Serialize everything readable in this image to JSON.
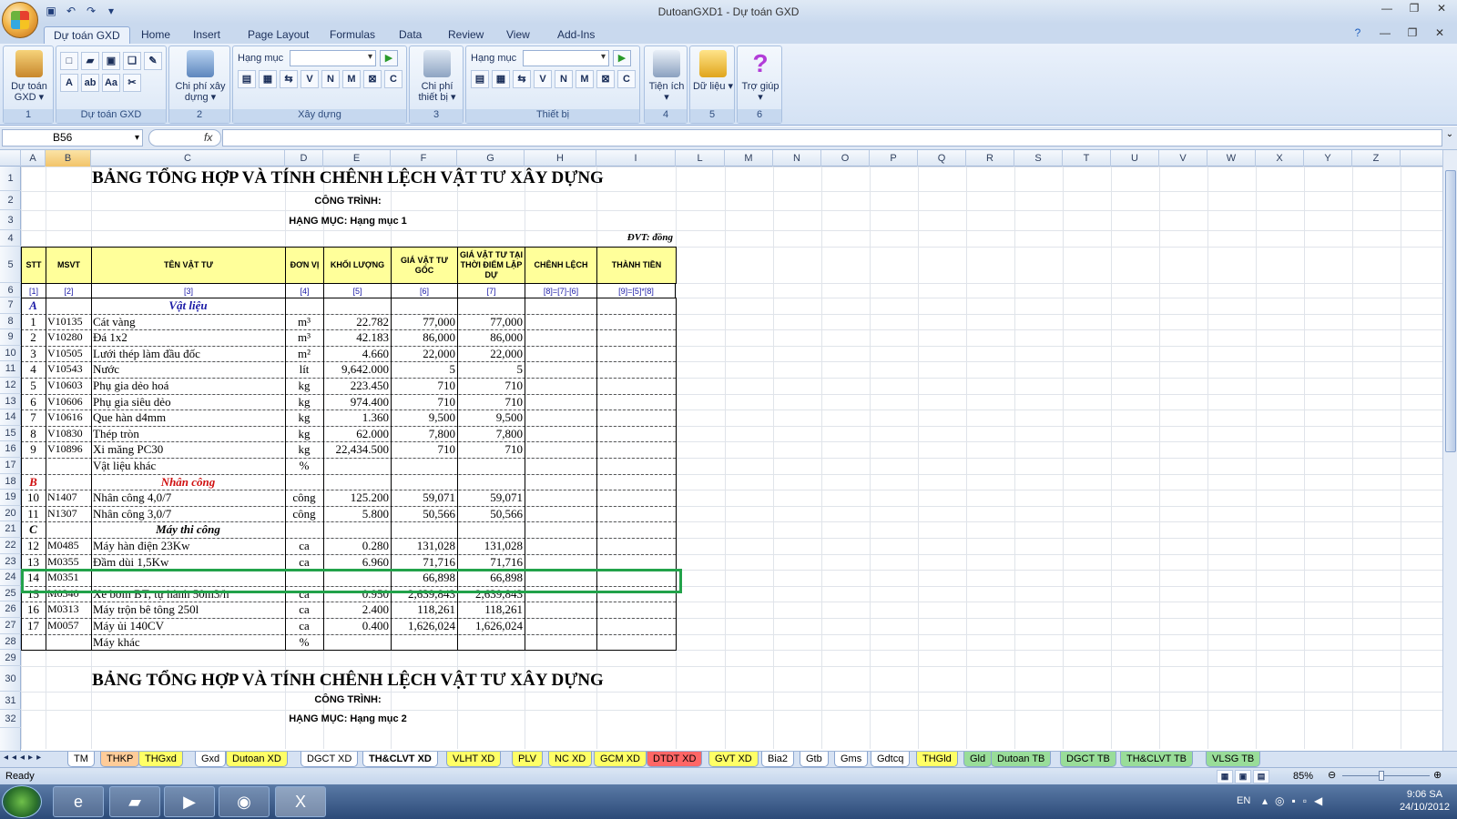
{
  "window": {
    "title": "DutoanGXD1 - Dự toán GXD"
  },
  "ribbon_tabs": [
    "Dự toán GXD",
    "Home",
    "Insert",
    "Page Layout",
    "Formulas",
    "Data",
    "Review",
    "View",
    "Add-Ins"
  ],
  "ribbon": {
    "groups": [
      {
        "label": "1",
        "button": "Dự toán GXD ▾"
      },
      {
        "label": "Dự toán GXD"
      },
      {
        "label": "2",
        "button": "Chi phí xây dựng ▾"
      },
      {
        "label": "Xây dựng",
        "dd_label": "Hạng mục",
        "small": [
          "V",
          "N",
          "M",
          "C"
        ]
      },
      {
        "label": "3",
        "button": "Chi phí thiết bị ▾"
      },
      {
        "label": "Thiết bị",
        "dd_label": "Hạng mục",
        "small": [
          "V",
          "N",
          "M",
          "C"
        ]
      },
      {
        "label": "4",
        "button": "Tiện ích ▾"
      },
      {
        "label": "5",
        "button": "Dữ liệu ▾"
      },
      {
        "label": "6",
        "button": "Trợ giúp ▾"
      }
    ]
  },
  "formula_bar": {
    "name_box": "B56",
    "fx": "fx",
    "value": ""
  },
  "columns": [
    "A",
    "B",
    "C",
    "D",
    "E",
    "F",
    "G",
    "H",
    "I",
    "L",
    "M",
    "N",
    "O",
    "P",
    "Q",
    "R",
    "S",
    "T",
    "U",
    "V",
    "W",
    "X",
    "Y",
    "Z"
  ],
  "sheet": {
    "title": "BẢNG TỔNG HỢP VÀ TÍNH CHÊNH LỆCH VẬT TƯ XÂY DỰNG",
    "cong_trinh": "CÔNG TRÌNH:",
    "hang_muc": "HẠNG MỤC: Hạng mục 1",
    "dvt": "ĐVT: đồng",
    "headers": [
      "STT",
      "MSVT",
      "TÊN VẬT TƯ",
      "ĐƠN VỊ",
      "KHỐI LƯỢNG",
      "GIÁ VẬT TƯ GỐC",
      "GIÁ VẬT TƯ TẠI THỜI ĐIỂM LẬP DỰ",
      "CHÊNH LỆCH",
      "THÀNH TIỀN"
    ],
    "codes": [
      "[1]",
      "[2]",
      "[3]",
      "[4]",
      "[5]",
      "[6]",
      "[7]",
      "[8]=[7]-[6]",
      "[9]=[5]*[8]"
    ],
    "rows": [
      {
        "r": "7",
        "stt": "A",
        "ms": "",
        "ten": "Vật liệu",
        "dv": "",
        "kl": "",
        "g1": "",
        "g2": "",
        "type": "sec-a"
      },
      {
        "r": "8",
        "stt": "1",
        "ms": "V10135",
        "ten": "Cát vàng",
        "dv": "m³",
        "kl": "22.782",
        "g1": "77,000",
        "g2": "77,000"
      },
      {
        "r": "9",
        "stt": "2",
        "ms": "V10280",
        "ten": "Đá 1x2",
        "dv": "m³",
        "kl": "42.183",
        "g1": "86,000",
        "g2": "86,000"
      },
      {
        "r": "10",
        "stt": "3",
        "ms": "V10505",
        "ten": "Lưới thép làm đầu đốc",
        "dv": "m²",
        "kl": "4.660",
        "g1": "22,000",
        "g2": "22,000"
      },
      {
        "r": "11",
        "stt": "4",
        "ms": "V10543",
        "ten": "Nước",
        "dv": "lít",
        "kl": "9,642.000",
        "g1": "5",
        "g2": "5"
      },
      {
        "r": "12",
        "stt": "5",
        "ms": "V10603",
        "ten": "Phụ gia dẻo hoá",
        "dv": "kg",
        "kl": "223.450",
        "g1": "710",
        "g2": "710"
      },
      {
        "r": "13",
        "stt": "6",
        "ms": "V10606",
        "ten": "Phụ gia siêu dẻo",
        "dv": "kg",
        "kl": "974.400",
        "g1": "710",
        "g2": "710"
      },
      {
        "r": "14",
        "stt": "7",
        "ms": "V10616",
        "ten": "Que hàn d4mm",
        "dv": "kg",
        "kl": "1.360",
        "g1": "9,500",
        "g2": "9,500"
      },
      {
        "r": "15",
        "stt": "8",
        "ms": "V10830",
        "ten": "Thép tròn",
        "dv": "kg",
        "kl": "62.000",
        "g1": "7,800",
        "g2": "7,800"
      },
      {
        "r": "16",
        "stt": "9",
        "ms": "V10896",
        "ten": "Xi măng PC30",
        "dv": "kg",
        "kl": "22,434.500",
        "g1": "710",
        "g2": "710"
      },
      {
        "r": "17",
        "stt": "",
        "ms": "",
        "ten": "Vật liệu khác",
        "dv": "%",
        "kl": "",
        "g1": "",
        "g2": ""
      },
      {
        "r": "18",
        "stt": "B",
        "ms": "",
        "ten": "Nhân công",
        "dv": "",
        "kl": "",
        "g1": "",
        "g2": "",
        "type": "sec-b"
      },
      {
        "r": "19",
        "stt": "10",
        "ms": "N1407",
        "ten": "Nhân công 4,0/7",
        "dv": "công",
        "kl": "125.200",
        "g1": "59,071",
        "g2": "59,071"
      },
      {
        "r": "20",
        "stt": "11",
        "ms": "N1307",
        "ten": "Nhân công 3,0/7",
        "dv": "công",
        "kl": "5.800",
        "g1": "50,566",
        "g2": "50,566"
      },
      {
        "r": "21",
        "stt": "C",
        "ms": "",
        "ten": "Máy thi công",
        "dv": "",
        "kl": "",
        "g1": "",
        "g2": "",
        "type": "sec-c"
      },
      {
        "r": "22",
        "stt": "12",
        "ms": "M0485",
        "ten": "Máy hàn điện 23Kw",
        "dv": "ca",
        "kl": "0.280",
        "g1": "131,028",
        "g2": "131,028"
      },
      {
        "r": "23",
        "stt": "13",
        "ms": "M0355",
        "ten": "Đầm dùi 1,5Kw",
        "dv": "ca",
        "kl": "6.960",
        "g1": "71,716",
        "g2": "71,716"
      },
      {
        "r": "24",
        "stt": "14",
        "ms": "M0351",
        "ten": "",
        "dv": "",
        "kl": "",
        "g1": "66,898",
        "g2": "66,898"
      },
      {
        "r": "25",
        "stt": "15",
        "ms": "M0340",
        "ten": "Xe bơm BT, tự hành 50m3/h",
        "dv": "ca",
        "kl": "0.950",
        "g1": "2,639,843",
        "g2": "2,639,843"
      },
      {
        "r": "26",
        "stt": "16",
        "ms": "M0313",
        "ten": "Máy trộn bê tông 250l",
        "dv": "ca",
        "kl": "2.400",
        "g1": "118,261",
        "g2": "118,261"
      },
      {
        "r": "27",
        "stt": "17",
        "ms": "M0057",
        "ten": "Máy ủi 140CV",
        "dv": "ca",
        "kl": "0.400",
        "g1": "1,626,024",
        "g2": "1,626,024"
      },
      {
        "r": "28",
        "stt": "",
        "ms": "",
        "ten": "Máy khác",
        "dv": "%",
        "kl": "",
        "g1": "",
        "g2": ""
      }
    ],
    "row_numbers_after": [
      "29",
      "30",
      "31",
      "32"
    ],
    "title2": "BẢNG TỔNG HỢP VÀ TÍNH CHÊNH LỆCH VẬT TƯ XÂY DỰNG",
    "cong_trinh2": "CÔNG TRÌNH:",
    "hang_muc2": "HẠNG MỤC: Hạng mục 2"
  },
  "sheet_tabs": [
    "TM",
    "THKP",
    "THGxd",
    "Gxd",
    "Dutoan XD",
    "DGCT XD",
    "TH&CLVT XD",
    "VLHT XD",
    "PLV",
    "NC XD",
    "GCM XD",
    "DTDT XD",
    "GVT XD",
    "Bia2",
    "Gtb",
    "Gms",
    "Gdtcq",
    "THGld",
    "Gld",
    "Dutoan TB",
    "DGCT TB",
    "TH&CLVT TB",
    "VLSG TB"
  ],
  "active_tab": "TH&CLVT XD",
  "status": {
    "ready": "Ready",
    "zoom": "85%"
  },
  "taskbar": {
    "lang": "EN",
    "time": "9:06 SA",
    "date": "24/10/2012"
  },
  "colors": {
    "selection": "#22a24a",
    "header_fill": "#ffff9a",
    "section_blue": "#1a1aa6",
    "section_red": "#d01010"
  }
}
